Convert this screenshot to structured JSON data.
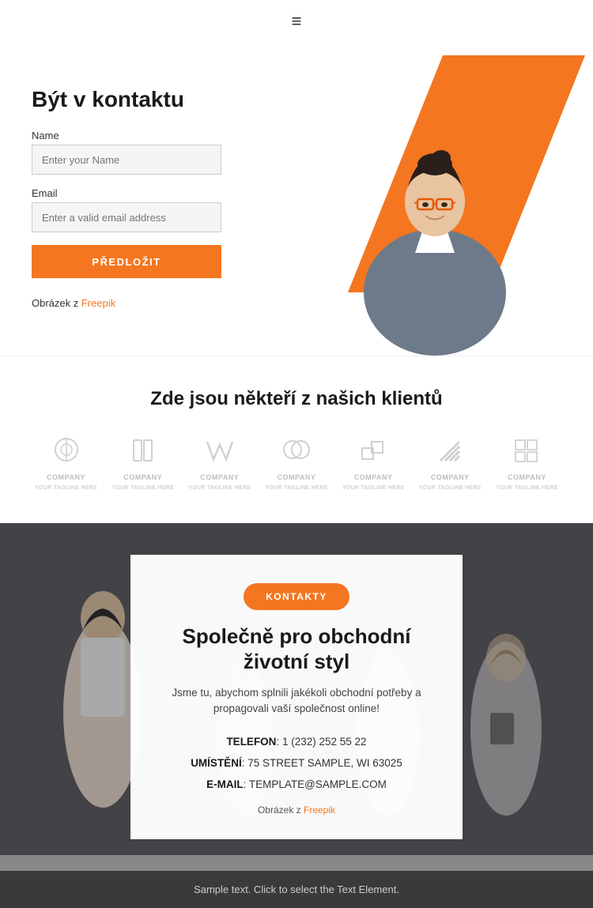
{
  "header": {
    "menu_icon": "≡"
  },
  "hero": {
    "title": "Být v kontaktu",
    "name_label": "Name",
    "name_placeholder": "Enter your Name",
    "email_label": "Email",
    "email_placeholder": "Enter a valid email address",
    "submit_label": "PŘEDLOŽIT",
    "credit_text": "Obrázek z ",
    "credit_link": "Freepik",
    "credit_url": "#"
  },
  "clients": {
    "title": "Zde jsou někteří z našich klientů",
    "logos": [
      {
        "id": 1,
        "label": "COMPANY"
      },
      {
        "id": 2,
        "label": "COMPANY"
      },
      {
        "id": 3,
        "label": "COMPANY"
      },
      {
        "id": 4,
        "label": "COMPANY"
      },
      {
        "id": 5,
        "label": "COMPANY"
      },
      {
        "id": 6,
        "label": "COMPANY"
      },
      {
        "id": 7,
        "label": "COMPANY"
      }
    ]
  },
  "contact": {
    "button_label": "KONTAKTY",
    "title": "Společně pro obchodní životní styl",
    "description": "Jsme tu, abychom splnili jakékoli obchodní potřeby a propagovali vaší společnost online!",
    "phone_label": "TELEFON",
    "phone_value": "1 (232) 252 55 22",
    "address_label": "UMÍSTĚNÍ",
    "address_value": "75 STREET SAMPLE, WI 63025",
    "email_label": "E-MAIL",
    "email_value": "TEMPLATE@SAMPLE.COM",
    "credit_text": "Obrázek z ",
    "credit_link": "Freepik",
    "credit_url": "#"
  },
  "footer": {
    "text": "Sample text. Click to select the Text Element."
  }
}
